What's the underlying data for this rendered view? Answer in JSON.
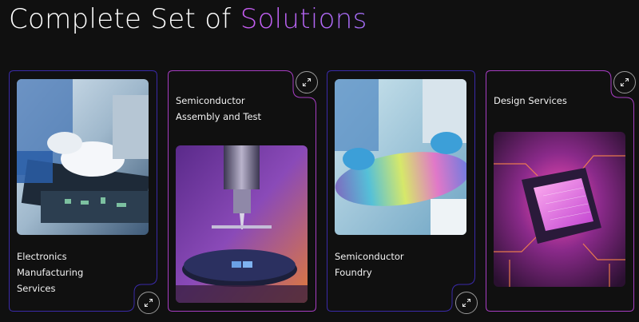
{
  "heading": {
    "prefix": "Complete Set of",
    "accent": "Solutions"
  },
  "colors": {
    "accent": "#b866f0",
    "border": "#3a2aa8",
    "border_pink": "#a63dc2",
    "background": "#101010"
  },
  "cards": [
    {
      "label_lines": [
        "Electronics",
        "Manufacturing",
        "Services"
      ],
      "image_icon": "circuit-board-assembly-image",
      "button_icon": "expand-arrows-icon"
    },
    {
      "label_lines": [
        "Semiconductor",
        "Assembly and Test"
      ],
      "image_icon": "wafer-probe-image",
      "button_icon": "expand-arrows-icon"
    },
    {
      "label_lines": [
        "Semiconductor",
        "Foundry"
      ],
      "image_icon": "silicon-wafer-image",
      "button_icon": "expand-arrows-icon"
    },
    {
      "label_lines": [
        "Design Services"
      ],
      "image_icon": "chip-render-image",
      "button_icon": "expand-arrows-icon"
    }
  ]
}
